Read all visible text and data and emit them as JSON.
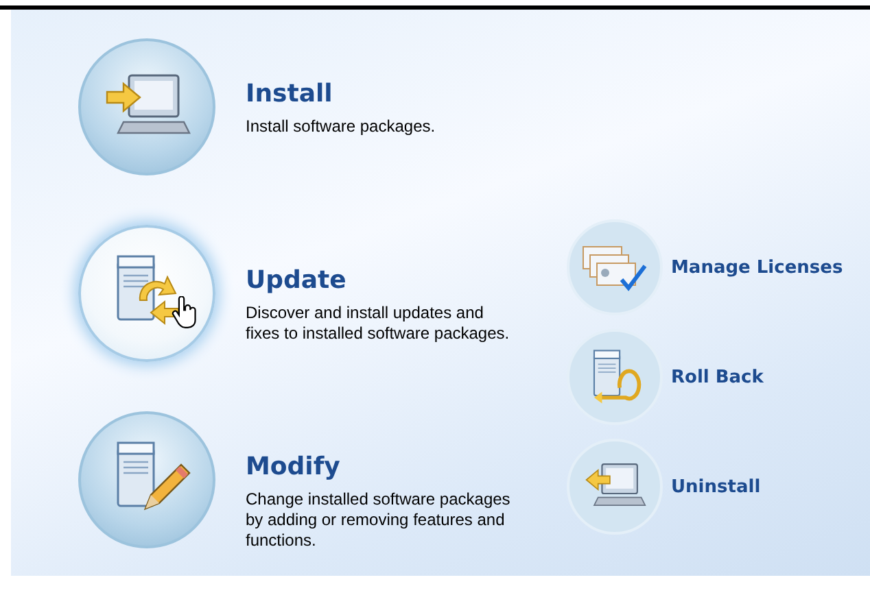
{
  "main_tasks": [
    {
      "kind": "install",
      "title": "Install",
      "description": "Install software packages.",
      "highlighted": false
    },
    {
      "kind": "update",
      "title": "Update",
      "description": "Discover and install updates and fixes to installed software packages.",
      "highlighted": true
    },
    {
      "kind": "modify",
      "title": "Modify",
      "description": "Change installed software packages by adding or removing features and functions.",
      "highlighted": false
    }
  ],
  "other_tasks": [
    {
      "kind": "licenses",
      "title": "Manage Licenses"
    },
    {
      "kind": "rollback",
      "title": "Roll Back"
    },
    {
      "kind": "uninstall",
      "title": "Uninstall"
    }
  ]
}
